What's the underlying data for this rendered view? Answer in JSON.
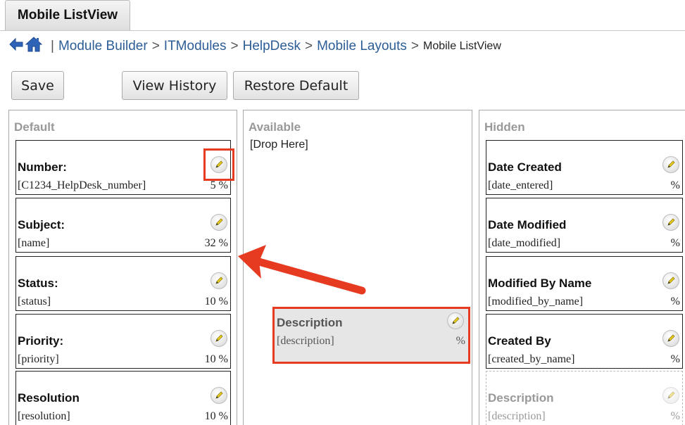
{
  "tab": {
    "label": "Mobile ListView"
  },
  "breadcrumb": {
    "separator": "|",
    "links": [
      "Module Builder",
      "ITModules",
      "HelpDesk",
      "Mobile Layouts"
    ],
    "arrow": ">",
    "current": "Mobile ListView"
  },
  "toolbar": {
    "save_label": "Save",
    "history_label": "View History",
    "restore_label": "Restore Default"
  },
  "panels": {
    "default": {
      "title": "Default",
      "fields": [
        {
          "label": "Number:",
          "name": "[C1234_HelpDesk_number]",
          "width": "5 %"
        },
        {
          "label": "Subject:",
          "name": "[name]",
          "width": "32 %"
        },
        {
          "label": "Status:",
          "name": "[status]",
          "width": "10 %"
        },
        {
          "label": "Priority:",
          "name": "[priority]",
          "width": "10 %"
        },
        {
          "label": "Resolution",
          "name": "[resolution]",
          "width": "10 %"
        }
      ]
    },
    "available": {
      "title": "Available",
      "drop_label": "[Drop Here]"
    },
    "hidden": {
      "title": "Hidden",
      "fields": [
        {
          "label": "Date Created",
          "name": "[date_entered]",
          "width": "%"
        },
        {
          "label": "Date Modified",
          "name": "[date_modified]",
          "width": "%"
        },
        {
          "label": "Modified By Name",
          "name": "[modified_by_name]",
          "width": "%"
        },
        {
          "label": "Created By",
          "name": "[created_by_name]",
          "width": "%"
        },
        {
          "label": "Description",
          "name": "[description]",
          "width": "%"
        }
      ]
    }
  },
  "dragging": {
    "label": "Description",
    "name": "[description]",
    "width": "%"
  },
  "colors": {
    "highlight": "#e63a21",
    "link": "#2d5d96",
    "panel_title": "#999999"
  },
  "icons": [
    "back-arrow-icon",
    "home-icon",
    "pencil-icon"
  ]
}
